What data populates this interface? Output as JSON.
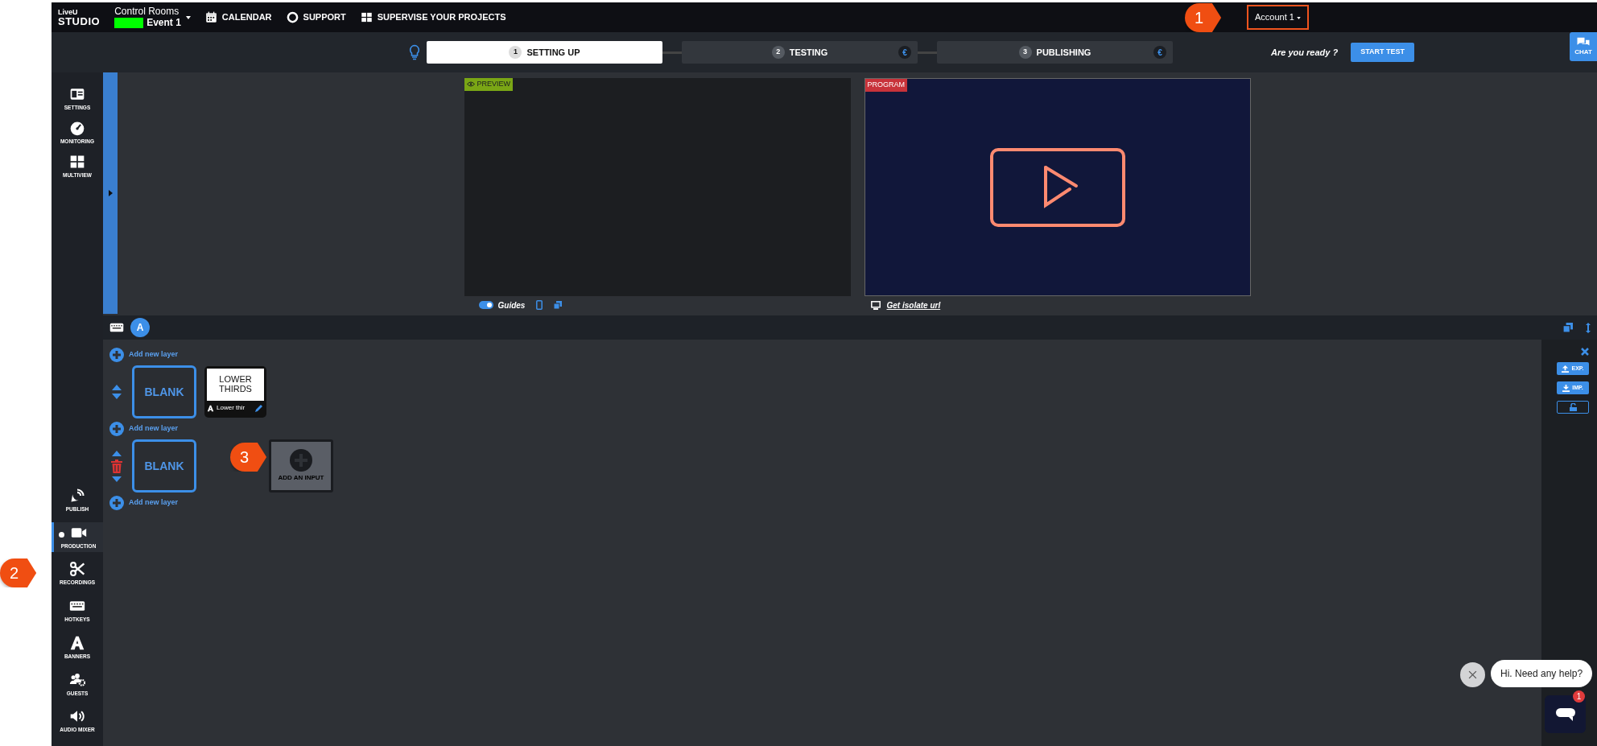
{
  "header": {
    "logo_top": "LiveU",
    "logo_bottom": "STUDIO",
    "rooms_label": "Control Rooms",
    "event": "Event 1",
    "nav": [
      {
        "kind": "calendar",
        "label": "CALENDAR"
      },
      {
        "kind": "support",
        "label": "SUPPORT"
      },
      {
        "kind": "projects",
        "label": "SUPERVISE YOUR PROJECTS"
      }
    ],
    "account": "Account 1"
  },
  "steps": [
    {
      "number": "1",
      "label": "SETTING UP",
      "selected": true
    },
    {
      "number": "2",
      "label": "TESTING",
      "selected": false,
      "currency": "€"
    },
    {
      "number": "3",
      "label": "PUBLISHING",
      "selected": false,
      "currency": "€"
    }
  ],
  "ready_prompt": "Are you ready ?",
  "start_button": "START TEST",
  "chat_button": "CHAT",
  "sidebar_top": [
    {
      "kind": "settings",
      "label": "SETTINGS"
    },
    {
      "kind": "monitoring",
      "label": "MONITORING"
    },
    {
      "kind": "multiview",
      "label": "MULTIVIEW"
    }
  ],
  "sidebar_bottom": [
    {
      "kind": "publish",
      "label": "PUBLISH",
      "selected": false
    },
    {
      "kind": "production",
      "label": "PRODUCTION",
      "selected": true
    },
    {
      "kind": "recordings",
      "label": "RECORDINGS",
      "selected": false
    },
    {
      "kind": "hotkeys",
      "label": "HOTKEYS",
      "selected": false
    },
    {
      "kind": "banners",
      "label": "BANNERS",
      "selected": false
    },
    {
      "kind": "guests",
      "label": "GUESTS",
      "selected": false
    },
    {
      "kind": "audio",
      "label": "AUDIO MIXER",
      "selected": false
    }
  ],
  "preview": {
    "label": "PREVIEW",
    "guides_label": "Guides",
    "guides_on": true
  },
  "program": {
    "label": "PROGRAM",
    "isolate_link": "Get isolate url"
  },
  "scene": "A",
  "add_layer_links": [
    "Add new layer",
    "Add new layer",
    "Add new layer"
  ],
  "layers": [
    {
      "blank": "BLANK",
      "deletable": false,
      "inputs": [
        {
          "kind": "graphic",
          "title": "LOWER THIRDS",
          "caption": "Lower thir"
        }
      ]
    },
    {
      "blank": "BLANK",
      "deletable": true,
      "inputs": [
        {
          "kind": "add",
          "label": "ADD AN INPUT"
        }
      ]
    }
  ],
  "side_panel": {
    "export": "EXP.",
    "import": "IMP.",
    "locked": false
  },
  "help": {
    "message": "Hi. Need any help?",
    "badge": "1"
  },
  "callouts": [
    "1",
    "2",
    "3"
  ]
}
